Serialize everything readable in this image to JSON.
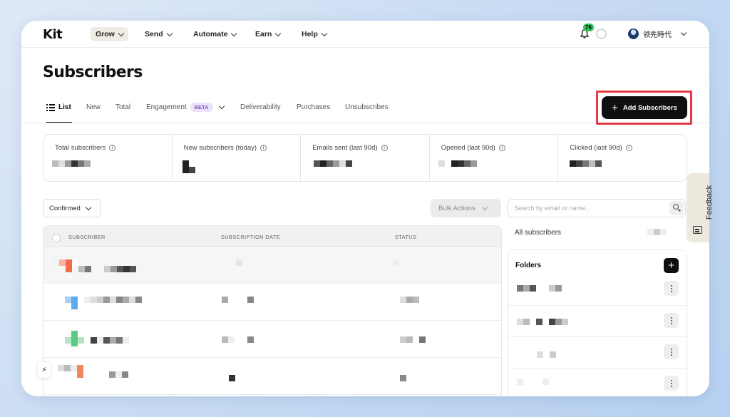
{
  "nav": {
    "logo": "Kit",
    "items": [
      {
        "label": "Grow",
        "active": true
      },
      {
        "label": "Send"
      },
      {
        "label": "Automate"
      },
      {
        "label": "Earn"
      },
      {
        "label": "Help"
      }
    ],
    "notification_count": "76",
    "account_name": "领先時代"
  },
  "page": {
    "title": "Subscribers",
    "tabs": [
      {
        "label": "List",
        "active": true
      },
      {
        "label": "New"
      },
      {
        "label": "Total"
      },
      {
        "label": "Engagement",
        "badge": "BETA"
      },
      {
        "label": "Deliverability"
      },
      {
        "label": "Purchases"
      },
      {
        "label": "Unsubscribes"
      }
    ],
    "add_button": "Add Subscribers"
  },
  "stats": [
    {
      "label": "Total subscribers"
    },
    {
      "label": "New subscribers (today)"
    },
    {
      "label": "Emails sent (last 90d)"
    },
    {
      "label": "Opened (last 90d)"
    },
    {
      "label": "Clicked (last 90d)"
    }
  ],
  "controls": {
    "filter_value": "Confirmed",
    "bulk_actions": "Bulk Actions",
    "search_placeholder": "Search by email or name..."
  },
  "table": {
    "columns": [
      "SUBSCRIBER",
      "SUBSCRIPTION DATE",
      "STATUS"
    ]
  },
  "sidebar": {
    "all_subscribers": "All subscribers",
    "folders_title": "Folders"
  },
  "feedback_label": "Feedback",
  "colors": {
    "accent_dark": "#0f0f0f",
    "highlight_border": "#e63946",
    "beta_bg": "#ece3fb",
    "beta_text": "#7b52c9",
    "notif_badge": "#2fbf5b"
  }
}
